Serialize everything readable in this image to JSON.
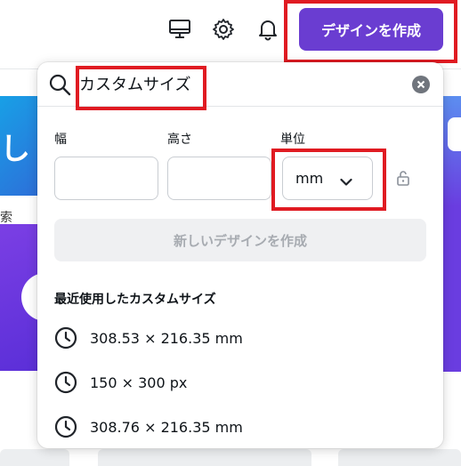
{
  "header": {
    "create_button_label": "デザインを作成",
    "icons": [
      "desktop-icon",
      "gear-icon",
      "bell-icon"
    ]
  },
  "background": {
    "hero_text": "し",
    "left_word": "索"
  },
  "custom_size_popup": {
    "search": {
      "value": "カスタムサイズ"
    },
    "width_label": "幅",
    "height_label": "高さ",
    "unit_label": "単位",
    "width_value": "",
    "height_value": "",
    "unit_value": "mm",
    "create_button_label": "新しいデザインを作成",
    "recent": {
      "title": "最近使用したカスタムサイズ",
      "items": [
        {
          "label": "308.53 × 216.35 mm"
        },
        {
          "label": "150 × 300 px"
        },
        {
          "label": "308.76 × 216.35 mm"
        }
      ]
    }
  },
  "colors": {
    "accent": "#6a3dd1",
    "annotation_red": "#e01b22"
  }
}
